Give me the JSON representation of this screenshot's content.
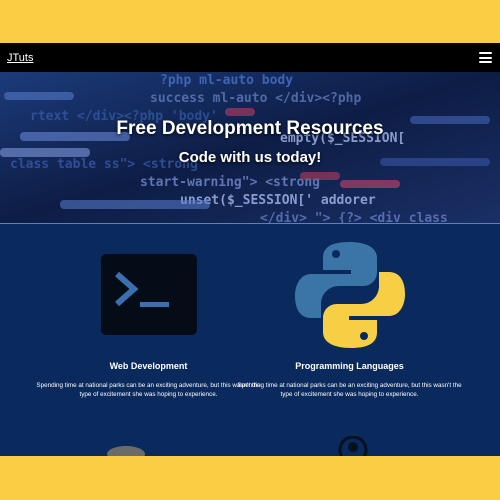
{
  "navbar": {
    "brand": "JTuts"
  },
  "hero": {
    "title": "Free Development Resources",
    "subtitle": "Code with us today!",
    "code_lines": [
      "?php  ml-auto  body",
      "success  ml-auto  </div><?php",
      "rtext  </div><?php  'body'",
      "empty($_SESSION[",
      "class  table  ss\">  <strong",
      "start-warning\">  <strong",
      "unset($_SESSION[' addorer",
      "</div>  \">  {?>  <div class"
    ]
  },
  "cards": [
    {
      "icon": "terminal-icon",
      "title": "Web Development",
      "text": "Spending time at national parks can be an exciting adventure, but this wasn't the type of excitement she was hoping to experience."
    },
    {
      "icon": "python-icon",
      "title": "Programming Languages",
      "text": "Spending time at national parks can be an exciting adventure, but this wasn't the type of excitement she was hoping to experience."
    }
  ],
  "colors": {
    "page_border": "#fbcd45",
    "content_bg": "#0a2a5e",
    "navbar_bg": "#000000",
    "python_blue": "#3b75a8",
    "python_yellow": "#f7cf45"
  }
}
